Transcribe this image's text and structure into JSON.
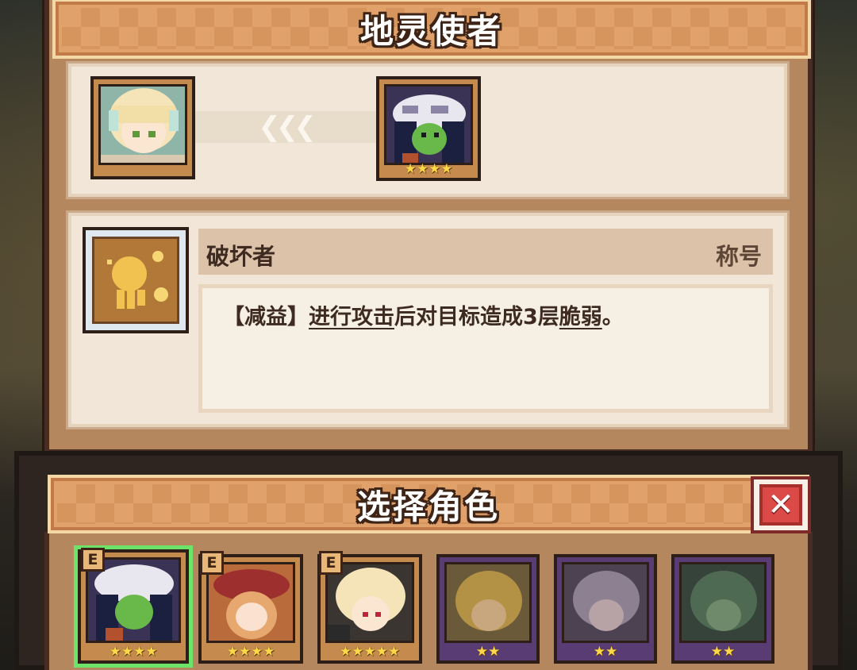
{
  "header": {
    "title": "地灵使者"
  },
  "transfer": {
    "from_stars": "",
    "to_stars": "★★★★",
    "arrows": "❮❮❮"
  },
  "trait": {
    "name": "破坏者",
    "tag": "称号",
    "desc_prefix": "【减益】",
    "desc_link1": "进行攻击",
    "desc_mid": "后对目标造成3层",
    "desc_link2": "脆弱",
    "desc_suffix": "。"
  },
  "select": {
    "title": "选择角色",
    "close_label": "✕",
    "characters": [
      {
        "badge": "E",
        "stars": "★★★★",
        "selected": true
      },
      {
        "badge": "E",
        "stars": "★★★★"
      },
      {
        "badge": "E",
        "stars": "★★★★★"
      },
      {
        "badge": "",
        "stars": "★★"
      },
      {
        "badge": "",
        "stars": "★★"
      },
      {
        "badge": "",
        "stars": "★★"
      }
    ]
  },
  "colors": {
    "accent": "#e0a16a",
    "panel": "#b5875e",
    "selected": "#6ee36a",
    "close": "#dc4a48"
  },
  "icons": {
    "trait_icon": "burst-fist-icon"
  }
}
